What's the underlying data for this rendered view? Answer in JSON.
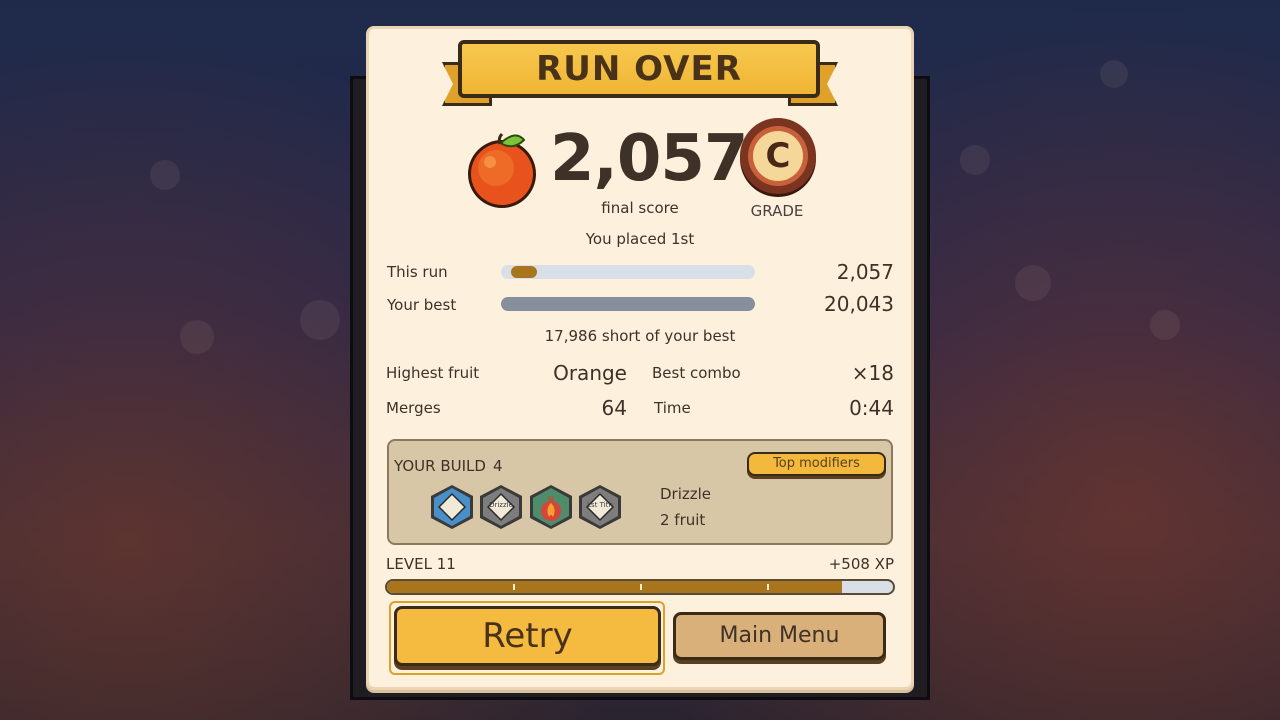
{
  "header": {
    "title": "RUN OVER"
  },
  "score": {
    "value": "2,057",
    "label": "final score",
    "fruit_icon": "orange-icon"
  },
  "grade": {
    "letter": "C",
    "label": "GRADE"
  },
  "placed": "You placed 1st",
  "comparison": {
    "this_run": {
      "label": "This run",
      "value": "2,057",
      "fill_fraction": 0.103
    },
    "your_best": {
      "label": "Your best",
      "value": "20,043",
      "fill_fraction": 1.0
    },
    "short_text": "17,986 short of your best"
  },
  "stats": {
    "highest_fruit": {
      "label": "Highest fruit",
      "value": "Orange"
    },
    "best_combo": {
      "label": "Best combo",
      "value": "×18"
    },
    "merges": {
      "label": "Merges",
      "value": "64"
    },
    "time": {
      "label": "Time",
      "value": "0:44"
    }
  },
  "build": {
    "title": "YOUR BUILD",
    "count": "4",
    "top_modifiers_label": "Top modifiers",
    "items": [
      {
        "icon": "blue-diamond-icon",
        "label": "",
        "color": "#4a90c8"
      },
      {
        "icon": "drizzle-icon",
        "label": "Drizzle",
        "color": "#7a7a7a"
      },
      {
        "icon": "fire-potion-icon",
        "label": "",
        "color": "#4a8a6a"
      },
      {
        "icon": "tithe-icon",
        "label": "Lst Tith",
        "color": "#7a7a7a"
      }
    ],
    "detail_name": "Drizzle",
    "detail_sub": "2 fruit"
  },
  "level": {
    "label": "LEVEL 11",
    "xp_gain": "+508 XP",
    "fill_fraction": 0.9
  },
  "buttons": {
    "retry": "Retry",
    "main_menu": "Main Menu"
  },
  "colors": {
    "accent": "#f4bb40",
    "progress": "#a8741c",
    "panel": "#fdf0dc"
  }
}
